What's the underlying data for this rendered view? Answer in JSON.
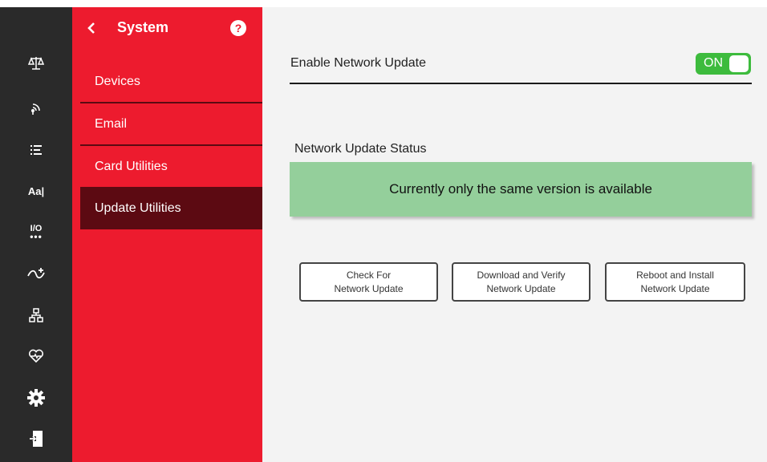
{
  "iconbar": {
    "icons": [
      "scale-icon",
      "signal-icon",
      "list-icon",
      "font-icon",
      "io-icon",
      "flow-icon",
      "network-icon",
      "health-icon",
      "gear-icon",
      "logout-icon"
    ],
    "font_label": "Aa|",
    "io_label": "I/O"
  },
  "sidebar": {
    "title": "System",
    "items": [
      {
        "label": "Devices",
        "active": false
      },
      {
        "label": "Email",
        "active": false
      },
      {
        "label": "Card Utilities",
        "active": false
      },
      {
        "label": "Update Utilities",
        "active": true
      }
    ]
  },
  "main": {
    "enable_label": "Enable Network Update",
    "toggle_label": "ON",
    "status_label": "Network Update Status",
    "status_message": "Currently only the same version is available",
    "buttons": [
      {
        "line1": "Check For",
        "line2": "Network Update"
      },
      {
        "line1": "Download and Verify",
        "line2": "Network Update"
      },
      {
        "line1": "Reboot and Install",
        "line2": "Network Update"
      }
    ]
  },
  "colors": {
    "sidebar_red": "#ed1b2e",
    "active_item": "#5c0a12",
    "iconbar_bg": "#2a2a2a",
    "status_green": "#94cf9b",
    "toggle_green": "#3dbb3d"
  }
}
